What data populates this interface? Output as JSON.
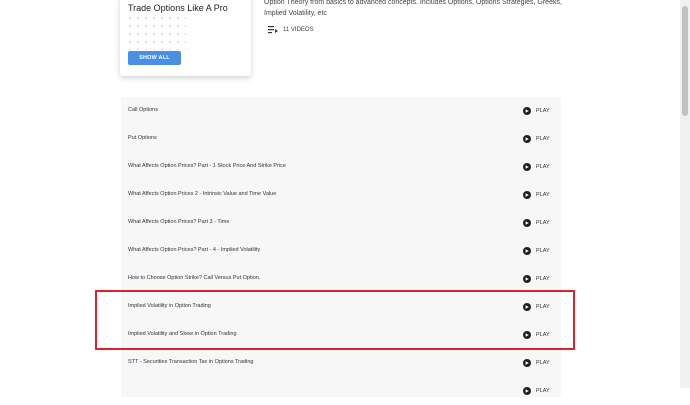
{
  "card": {
    "title": "Trade Options Like A Pro",
    "button_label": "SHOW ALL"
  },
  "description": "Option Theory from basics to advanced concepts. Includes Options, Options Strategies, Greeks, Implied Volatility, etc",
  "video_count_label": "11 VIDEOS",
  "play_label": "PLAY",
  "rows": [
    "Call Options",
    "Put Options",
    "What Affects Option Prices? Part - 1 Stock Price And Strike Price",
    "What Affects Option Prices 2 - Intrinsic Value and Time Value",
    "What Affects Option Prices? Part 3 - Time",
    "What Affects Option Prices? Part - 4 - Implied Volatility",
    "How to Choose Option Strike? Call Versus Put Option.",
    "Implied Volatility in Option Trading",
    "Implied Volatility and Skew in Option Trading",
    "STT - Securities Transaction Tax in Options Trading",
    ""
  ],
  "colors": {
    "accent": "#4a90e2",
    "highlight": "#d9232d"
  }
}
